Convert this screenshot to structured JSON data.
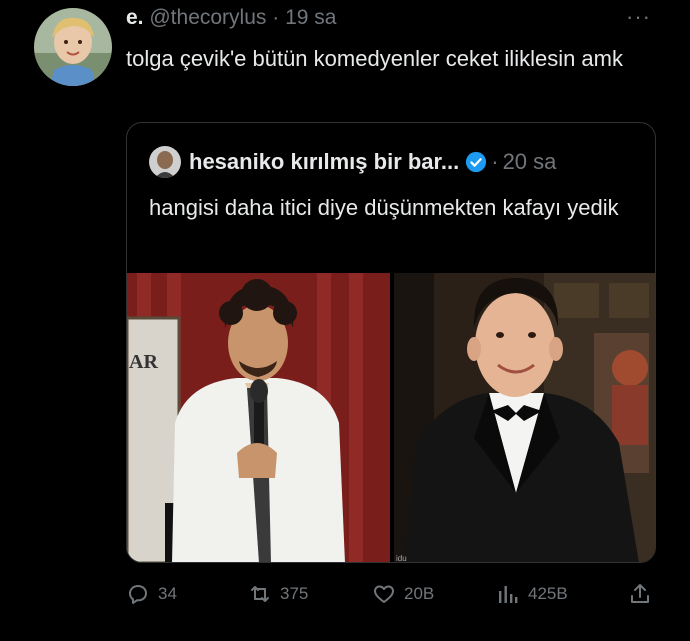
{
  "tweet": {
    "display_name": "e.",
    "handle": "@thecorylus",
    "separator": "·",
    "time": "19 sa",
    "more_label": "···",
    "text": "tolga çevik'e bütün komedyenler ceket iliklesin amk"
  },
  "quoted": {
    "display_name": "hesaniko kırılmış bir bar...",
    "separator": "·",
    "time": "20 sa",
    "text": "hangisi daha itici diye düşünmekten kafayı yedik",
    "verified": true
  },
  "actions": {
    "reply_count": "34",
    "retweet_count": "375",
    "like_count": "20B",
    "view_count": "425B"
  },
  "colors": {
    "background": "#000000",
    "text": "#e7e9ea",
    "muted": "#71767b",
    "border": "#2f3336",
    "verified": "#1d9bf0"
  }
}
